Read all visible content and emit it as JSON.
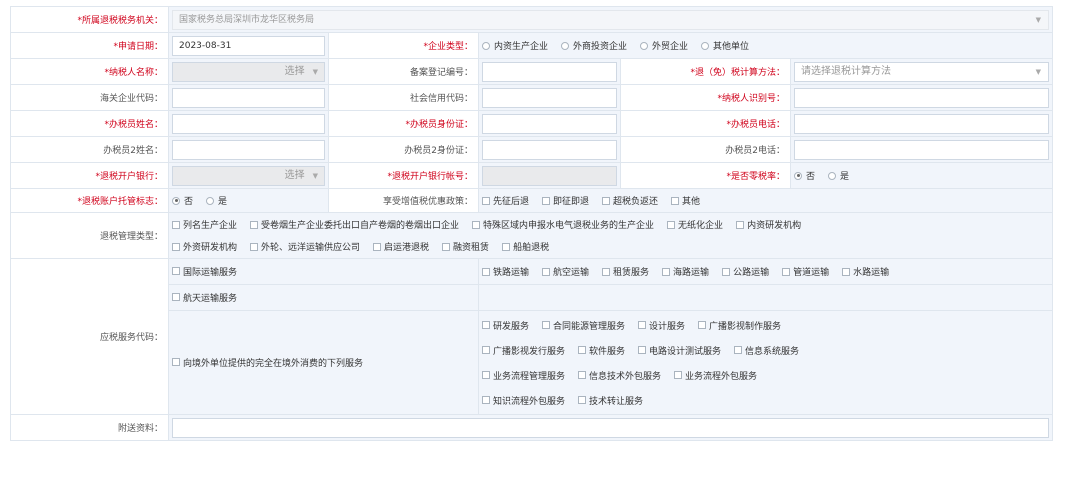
{
  "tax_office": {
    "label": "*所属退税税务机关：",
    "value": "国家税务总局深圳市龙华区税务局"
  },
  "apply_date": {
    "label": "*申请日期：",
    "value": "2023-08-31"
  },
  "enterprise_type": {
    "label": "*企业类型：",
    "options": [
      "内资生产企业",
      "外商投资企业",
      "外贸企业",
      "其他单位"
    ]
  },
  "taxpayer_name": {
    "label": "*纳税人名称：",
    "picker_text": "选择"
  },
  "record_no": {
    "label": "备案登记编号：",
    "value": ""
  },
  "refund_method": {
    "label": "*退（免）税计算方法：",
    "placeholder": "请选择退税计算方法"
  },
  "customs_code": {
    "label": "海关企业代码：",
    "value": ""
  },
  "credit_code": {
    "label": "社会信用代码：",
    "value": ""
  },
  "taxpayer_id": {
    "label": "*纳税人识别号：",
    "value": ""
  },
  "officer_name": {
    "label": "*办税员姓名：",
    "value": ""
  },
  "officer_id": {
    "label": "*办税员身份证：",
    "value": ""
  },
  "officer_phone": {
    "label": "*办税员电话：",
    "value": ""
  },
  "officer2_name": {
    "label": "办税员2姓名：",
    "value": ""
  },
  "officer2_id": {
    "label": "办税员2身份证：",
    "value": ""
  },
  "officer2_phone": {
    "label": "办税员2电话：",
    "value": ""
  },
  "bank": {
    "label": "*退税开户银行：",
    "picker_text": "选择"
  },
  "bank_account": {
    "label": "*退税开户银行帐号：",
    "value": ""
  },
  "zero_rate": {
    "label": "*是否零税率：",
    "options": [
      "否",
      "是"
    ],
    "selected": "否"
  },
  "custody": {
    "label": "*退税账户托管标志：",
    "options": [
      "否",
      "是"
    ],
    "selected": "否"
  },
  "vat_policy": {
    "label": "享受增值税优惠政策：",
    "options": [
      "先征后退",
      "即征即退",
      "超税负返还",
      "其他"
    ]
  },
  "management_type": {
    "label": "退税管理类型：",
    "row1": [
      "列名生产企业",
      "受卷烟生产企业委托出口自产卷烟的卷烟出口企业",
      "特殊区域内申报水电气退税业务的生产企业",
      "无纸化企业",
      "内资研发机构"
    ],
    "row2": [
      "外资研发机构",
      "外轮、远洋运输供应公司",
      "启运港退税",
      "融资租赁",
      "船舶退税"
    ]
  },
  "service_codes": {
    "label": "应税服务代码：",
    "intl_transport": "国际运输服务",
    "transport_types": [
      "铁路运输",
      "航空运输",
      "租赁服务",
      "海路运输",
      "公路运输",
      "管道运输",
      "水路运输"
    ],
    "space_transport": "航天运输服务",
    "overseas": "向境外单位提供的完全在境外消费的下列服务",
    "overseas_row1": [
      "研发服务",
      "合同能源管理服务",
      "设计服务",
      "广播影视制作服务"
    ],
    "overseas_row2": [
      "广播影视发行服务",
      "软件服务",
      "电路设计测试服务",
      "信息系统服务"
    ],
    "overseas_row3": [
      "业务流程管理服务",
      "信息技术外包服务",
      "业务流程外包服务"
    ],
    "overseas_row4": [
      "知识流程外包服务",
      "技术转让服务"
    ]
  },
  "attachments": {
    "label": "附送资料：",
    "value": ""
  }
}
